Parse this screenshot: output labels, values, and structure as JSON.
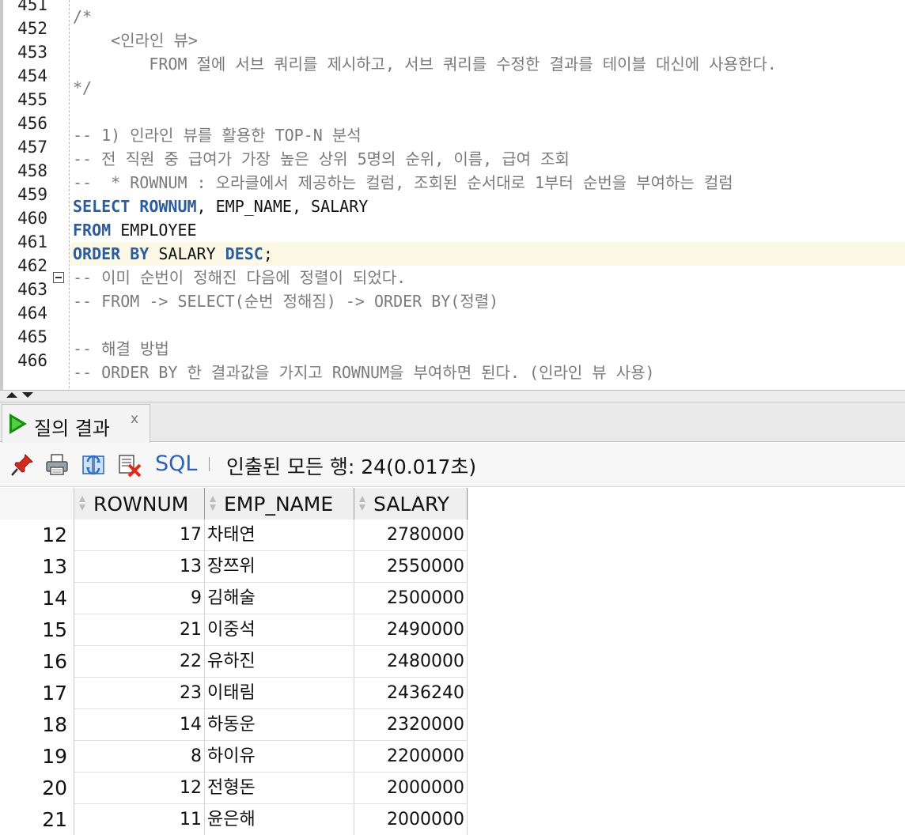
{
  "editor": {
    "lines": [
      {
        "num": "451",
        "text": "/*"
      },
      {
        "num": "452",
        "text": "    <인라인 뷰>"
      },
      {
        "num": "453",
        "text": "        FROM 절에 서브 쿼리를 제시하고, 서브 쿼리를 수정한 결과를 테이블 대신에 사용한다."
      },
      {
        "num": "454",
        "text": "*/"
      },
      {
        "num": "455",
        "text": ""
      },
      {
        "num": "456",
        "text": "-- 1) 인라인 뷰를 활용한 TOP-N 분석"
      },
      {
        "num": "457",
        "text": "-- 전 직원 중 급여가 가장 높은 상위 5명의 순위, 이름, 급여 조회"
      },
      {
        "num": "458",
        "text": "--  * ROWNUM : 오라클에서 제공하는 컬럼, 조회된 순서대로 1부터 순번을 부여하는 컬럼"
      },
      {
        "num": "459",
        "kw1": "SELECT",
        "kw2": " ROWNUM",
        "rest": ", EMP_NAME, SALARY"
      },
      {
        "num": "460",
        "kw1": "FROM",
        "rest": " EMPLOYEE"
      },
      {
        "num": "461",
        "kw1": "ORDER BY",
        "mid": " SALARY ",
        "kw2": "DESC",
        "rest": ";"
      },
      {
        "num": "462",
        "text": "-- 이미 순번이 정해진 다음에 정렬이 되었다."
      },
      {
        "num": "463",
        "text": "-- FROM -> SELECT(순번 정해짐) -> ORDER BY(정렬)"
      },
      {
        "num": "464",
        "text": ""
      },
      {
        "num": "465",
        "text": "-- 해결 방법"
      },
      {
        "num": "466",
        "text": "-- ORDER BY 한 결과값을 가지고 ROWNUM을 부여하면 된다. (인라인 뷰 사용)"
      }
    ]
  },
  "results": {
    "tab_label": "질의 결과",
    "tab_close": "x",
    "toolbar": {
      "pin_icon": "pin-icon",
      "print_icon": "print-icon",
      "refresh_icon": "refresh-icon",
      "cancel_icon": "cancel-icon",
      "sql_label": "SQL",
      "fetched_text": "인출된 모든 행: 24(0.017초)"
    },
    "columns": [
      "ROWNUM",
      "EMP_NAME",
      "SALARY"
    ],
    "rows": [
      {
        "idx": "12",
        "rownum": "17",
        "emp_name": "차태연",
        "salary": "2780000"
      },
      {
        "idx": "13",
        "rownum": "13",
        "emp_name": "장쯔위",
        "salary": "2550000"
      },
      {
        "idx": "14",
        "rownum": "9",
        "emp_name": "김해술",
        "salary": "2500000"
      },
      {
        "idx": "15",
        "rownum": "21",
        "emp_name": "이중석",
        "salary": "2490000"
      },
      {
        "idx": "16",
        "rownum": "22",
        "emp_name": "유하진",
        "salary": "2480000"
      },
      {
        "idx": "17",
        "rownum": "23",
        "emp_name": "이태림",
        "salary": "2436240"
      },
      {
        "idx": "18",
        "rownum": "14",
        "emp_name": "하동운",
        "salary": "2320000"
      },
      {
        "idx": "19",
        "rownum": "8",
        "emp_name": "하이유",
        "salary": "2200000"
      },
      {
        "idx": "20",
        "rownum": "12",
        "emp_name": "전형돈",
        "salary": "2000000"
      },
      {
        "idx": "21",
        "rownum": "11",
        "emp_name": "윤은해",
        "salary": "2000000"
      }
    ]
  },
  "colors": {
    "keyword": "#2a5d9f",
    "comment": "#7b7b7b",
    "current_line": "#fcf8e6",
    "sql_link": "#2d62b8",
    "run_icon": "#1b8a12"
  }
}
